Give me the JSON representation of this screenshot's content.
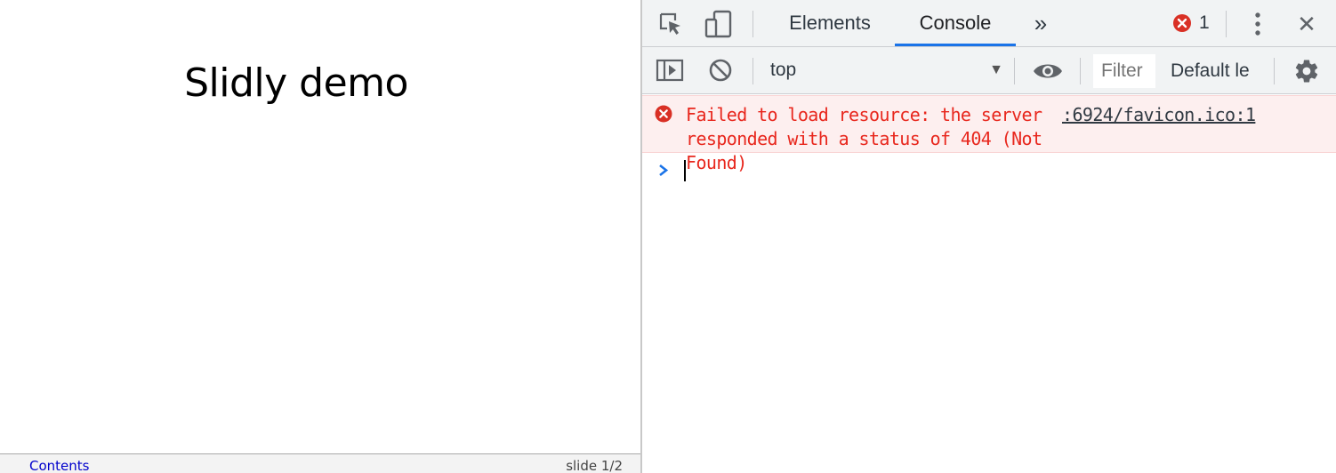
{
  "page": {
    "slide_title": "Slidly demo",
    "footer": {
      "contents_link": "Contents",
      "slide_indicator": "slide 1/2"
    }
  },
  "devtools": {
    "tabs": [
      {
        "label": "Elements",
        "active": false
      },
      {
        "label": "Console",
        "active": true
      }
    ],
    "more_tabs_glyph": "»",
    "error_count": "1",
    "close_glyph": "✕",
    "toolbar": {
      "context": "top",
      "filter_placeholder": "Filter",
      "levels_label": "Default le"
    },
    "messages": [
      {
        "level": "error",
        "text": "Failed to load resource: the server responded with a status of 404 (Not Found)",
        "source": ":6924/favicon.ico:1"
      }
    ],
    "icons": {
      "inspect": "inspect-element-icon",
      "device": "device-toolbar-icon",
      "sidebar": "console-sidebar-icon",
      "clear": "clear-console-icon",
      "eye": "live-expression-icon",
      "gear": "settings-gear-icon",
      "kebab": "more-options-icon"
    },
    "colors": {
      "accent": "#1a73e8",
      "error_red": "#e8271d",
      "error_bg": "#fdefef",
      "toolbar_bg": "#f1f3f4"
    }
  }
}
